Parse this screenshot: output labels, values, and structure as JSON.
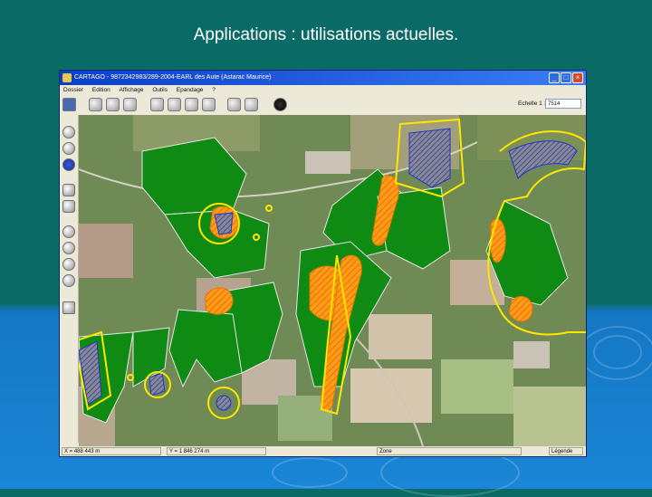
{
  "slide": {
    "title": "Applications : utilisations actuelles."
  },
  "window": {
    "title": "CARTAGO - 9872342983/289-2004-EARL des Aute (Astarac Maurice)",
    "controls": [
      "_",
      "□",
      "×"
    ]
  },
  "menu": {
    "items": [
      "Dossier",
      "Edition",
      "Affichage",
      "Outils",
      "Epandage",
      "?"
    ]
  },
  "toolbar": {
    "scale_label": "Echelle 1 :",
    "scale_value": "7514",
    "buttons": [
      "save",
      "zoom-in",
      "zoom-out",
      "pan",
      "edit-parcel",
      "edit-zone",
      "print-preview",
      "print",
      "export",
      "info"
    ]
  },
  "left_tools": [
    "measure",
    "select",
    "delete",
    "layers",
    "properties",
    "circle",
    "circle-alt",
    "line",
    "point",
    "legend"
  ],
  "status": {
    "coord_x": "X = 488 443 m",
    "coord_y": "Y = 1 846 274 m",
    "zone": "Zone",
    "legend": "Légende"
  },
  "colors": {
    "parcel_green": "#0f8a12",
    "spread_orange": "#ff9a1a",
    "exclusion_yellow": "#ffe600",
    "wetland_blue": "#2233cc"
  }
}
